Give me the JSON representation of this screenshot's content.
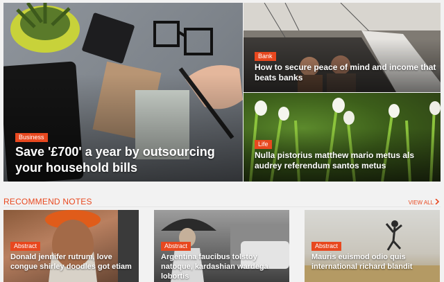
{
  "hero": {
    "main": {
      "category": "Business",
      "title": "Save '£700' a year by outsourcing your household bills"
    },
    "top_right": {
      "category": "Bank",
      "title": "How to secure peace of mind and income that beats banks"
    },
    "bottom_right": {
      "category": "Life",
      "title": "Nulla pistorius matthew mario metus als audrey referendum santos metus"
    }
  },
  "recommend": {
    "heading": "RECOMMEND NOTES",
    "view_all": "VIEW ALL",
    "view_all_icon": "chevron-right-icon",
    "cards": [
      {
        "category": "Abstract",
        "title": "Donald jennifer rutrum, love congue shirley doodles got etiam"
      },
      {
        "category": "Abstract",
        "title": "Argentina faucibus tolstoy natoque, kardashian wardega lobortis"
      },
      {
        "category": "Abstract",
        "title": "Mauris euismod odio quis international richard blandit"
      }
    ]
  },
  "colors": {
    "accent": "#e8481f",
    "background": "#f2f2f2"
  }
}
